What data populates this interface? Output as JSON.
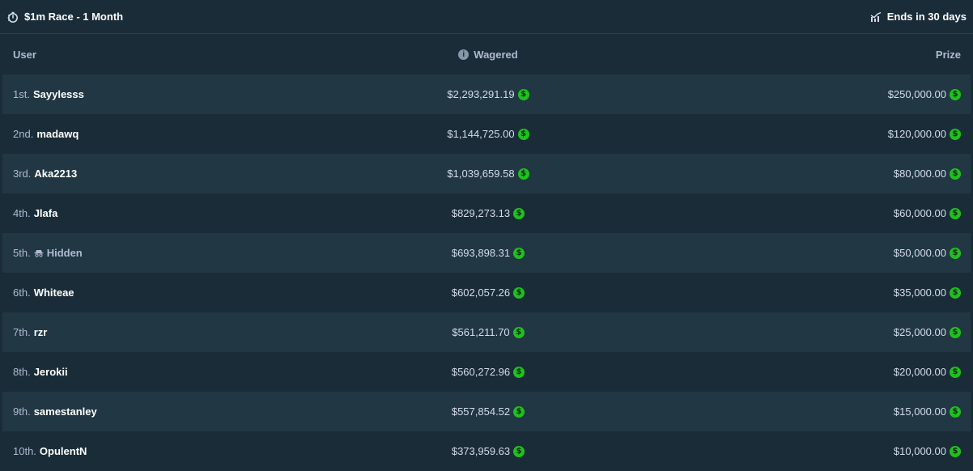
{
  "header": {
    "title": "$1m Race - 1 Month",
    "ends": "Ends in 30 days"
  },
  "table": {
    "columns": {
      "user": "User",
      "wagered": "Wagered",
      "prize": "Prize"
    },
    "info_glyph": "i",
    "coin_glyph": "$",
    "rows": [
      {
        "rank": "1st.",
        "user": "Sayylesss",
        "wagered": "$2,293,291.19",
        "prize": "$250,000.00"
      },
      {
        "rank": "2nd.",
        "user": "madawq",
        "wagered": "$1,144,725.00",
        "prize": "$120,000.00"
      },
      {
        "rank": "3rd.",
        "user": "Aka2213",
        "wagered": "$1,039,659.58",
        "prize": "$80,000.00"
      },
      {
        "rank": "4th.",
        "user": "Jlafa",
        "wagered": "$829,273.13",
        "prize": "$60,000.00"
      },
      {
        "rank": "5th.",
        "user": "Hidden",
        "hidden": true,
        "wagered": "$693,898.31",
        "prize": "$50,000.00"
      },
      {
        "rank": "6th.",
        "user": "Whiteae",
        "wagered": "$602,057.26",
        "prize": "$35,000.00"
      },
      {
        "rank": "7th.",
        "user": "rzr",
        "wagered": "$561,211.70",
        "prize": "$25,000.00"
      },
      {
        "rank": "8th.",
        "user": "Jerokii",
        "wagered": "$560,272.96",
        "prize": "$20,000.00"
      },
      {
        "rank": "9th.",
        "user": "samestanley",
        "wagered": "$557,854.52",
        "prize": "$15,000.00"
      },
      {
        "rank": "10th.",
        "user": "OpulentN",
        "wagered": "$373,959.63",
        "prize": "$10,000.00"
      }
    ]
  },
  "colors": {
    "background": "#1a2c38",
    "row_alt": "#213743",
    "coin": "#1fc01f",
    "text_muted": "#b1bad3"
  },
  "icons": {
    "race": "stopwatch-icon",
    "ends": "chart-icon",
    "info": "info-icon",
    "hidden": "incognito-icon",
    "currency": "dollar-coin-icon"
  }
}
